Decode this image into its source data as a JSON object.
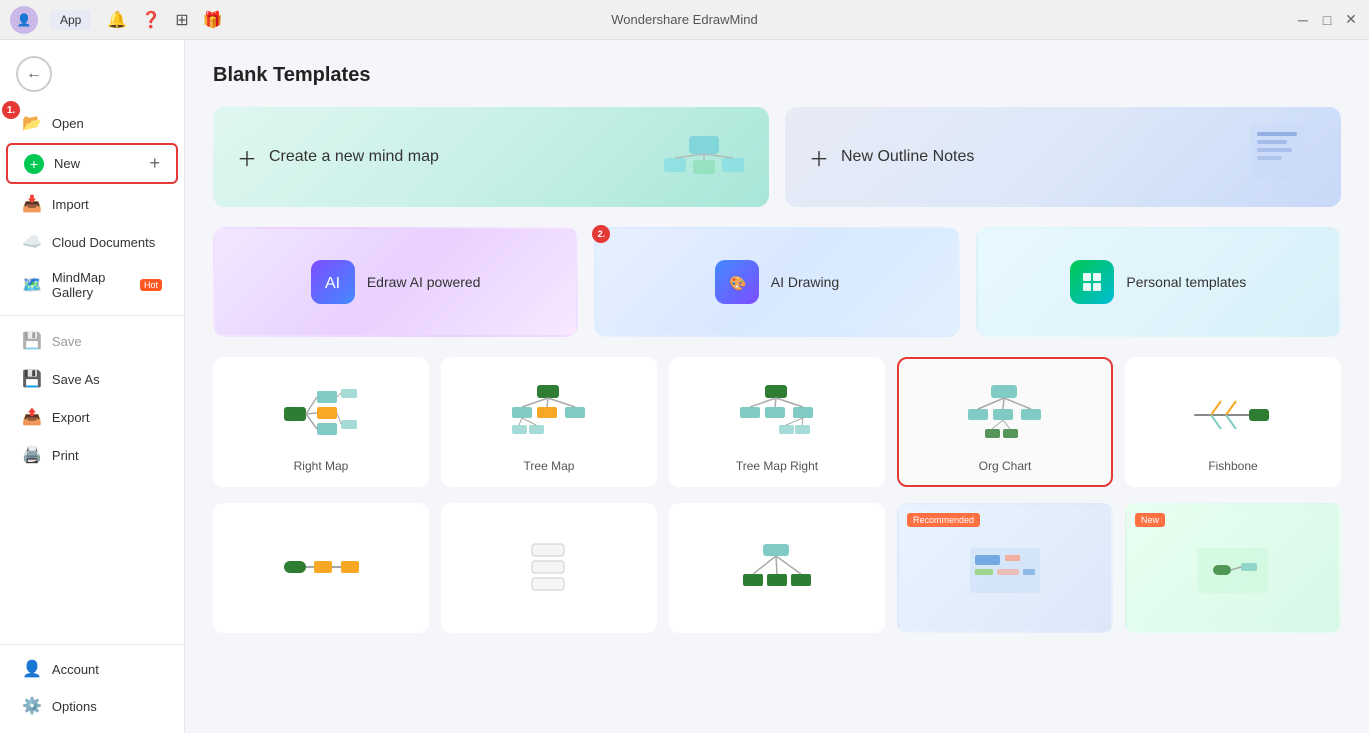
{
  "titlebar": {
    "title": "Wondershare EdrawMind",
    "app_btn": "App"
  },
  "sidebar": {
    "back_label": "←",
    "items": [
      {
        "id": "open",
        "label": "Open",
        "icon": "📂",
        "active": false,
        "step": "1"
      },
      {
        "id": "new",
        "label": "New",
        "icon": "➕",
        "active": true,
        "has_plus": true
      },
      {
        "id": "import",
        "label": "Import",
        "icon": "📥",
        "active": false
      },
      {
        "id": "cloud",
        "label": "Cloud Documents",
        "icon": "☁️",
        "active": false
      },
      {
        "id": "mindmap-gallery",
        "label": "MindMap Gallery",
        "icon": "🗺️",
        "active": false,
        "hot": true
      },
      {
        "id": "save",
        "label": "Save",
        "icon": "💾",
        "active": false
      },
      {
        "id": "save-as",
        "label": "Save As",
        "icon": "💾",
        "active": false
      },
      {
        "id": "export",
        "label": "Export",
        "icon": "📤",
        "active": false
      },
      {
        "id": "print",
        "label": "Print",
        "icon": "🖨️",
        "active": false
      }
    ],
    "bottom_items": [
      {
        "id": "account",
        "label": "Account",
        "icon": "👤"
      },
      {
        "id": "options",
        "label": "Options",
        "icon": "⚙️"
      }
    ]
  },
  "content": {
    "page_title": "Blank Templates",
    "banners": [
      {
        "id": "create-mindmap",
        "label": "Create a new mind map",
        "gradient": "green"
      },
      {
        "id": "outline-notes",
        "label": "New Outline Notes",
        "gradient": "blue"
      }
    ],
    "template_section": {
      "items": [
        {
          "id": "edraw-ai",
          "label": "Edraw AI powered",
          "icon": "🤖",
          "bg": "linear-gradient(135deg,#f3e8ff,#e8d8ff)"
        },
        {
          "id": "ai-drawing",
          "label": "AI Drawing",
          "icon": "🎨",
          "bg": "linear-gradient(135deg,#e8f0ff,#d8e8ff)",
          "step": "2"
        },
        {
          "id": "personal-templates",
          "label": "Personal templates",
          "icon": "📋",
          "bg": "linear-gradient(135deg,#e8fff0,#d8f8e8)"
        }
      ]
    },
    "map_templates": [
      {
        "id": "right-map",
        "label": "Right Map",
        "type": "right-map"
      },
      {
        "id": "tree-map",
        "label": "Tree Map",
        "type": "tree-map"
      },
      {
        "id": "tree-map-right",
        "label": "Tree Map Right",
        "type": "tree-map-right"
      },
      {
        "id": "org-chart",
        "label": "Org Chart",
        "type": "org-chart",
        "selected": true
      },
      {
        "id": "fishbone",
        "label": "Fishbone",
        "type": "fishbone"
      }
    ],
    "bottom_templates": [
      {
        "id": "flow1",
        "label": "",
        "type": "flow",
        "gradient": "plain"
      },
      {
        "id": "flow2",
        "label": "",
        "type": "flow2",
        "gradient": "plain"
      },
      {
        "id": "flow3",
        "label": "",
        "type": "flow3",
        "gradient": "plain"
      },
      {
        "id": "recommended",
        "label": "Recommended",
        "badge": "Recommended",
        "gradient": "blue"
      },
      {
        "id": "new-template",
        "label": "New",
        "badge": "New",
        "gradient": "green"
      }
    ]
  },
  "steps": {
    "step1": "1.",
    "step2": "2."
  }
}
